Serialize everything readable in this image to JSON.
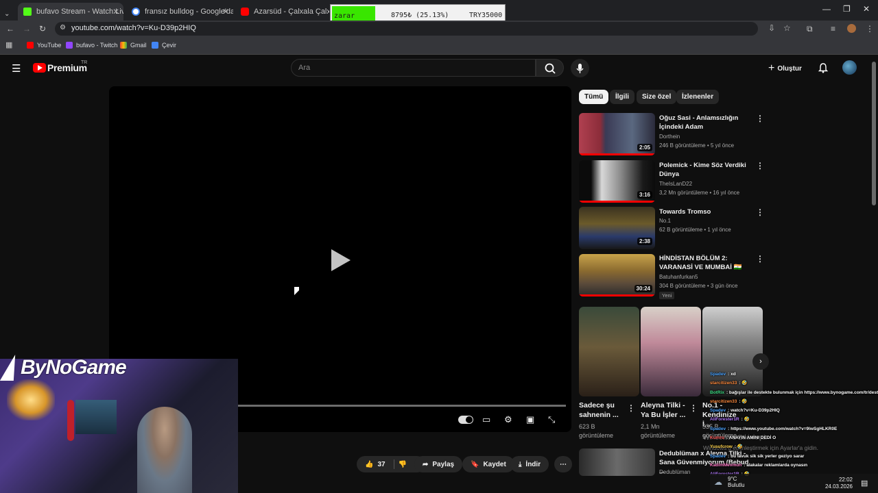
{
  "browser": {
    "tabs": [
      {
        "title": "bufavo Stream - Watch Live on",
        "color": "#53fc18"
      },
      {
        "title": "fransız bulldog - Google'da Ara",
        "color": "#4285f4"
      },
      {
        "title": "Azarsüd - Çalxala Çalxala Rekl",
        "color": "#ff0000"
      }
    ],
    "url": "youtube.com/watch?v=Ku-D39p2HIQ",
    "bookmarks": [
      "YouTube",
      "bufavo - Twitch",
      "Gmail",
      "Çevir"
    ]
  },
  "ticker": {
    "status": "zarar",
    "value": "8795₺ (25.13%)",
    "target": "TRY35000"
  },
  "masthead": {
    "logo": "Premium",
    "country": "TR",
    "search_placeholder": "Ara",
    "create_label": "Oluştur"
  },
  "action_bar": {
    "likes": "37",
    "share": "Paylaş",
    "save": "Kaydet",
    "download": "İndir"
  },
  "overlay": {
    "streamer_logo": "ByNoGame"
  },
  "chips": [
    "Tümü",
    "İlgili",
    "Size özel",
    "İzlenenler"
  ],
  "recommendations": [
    {
      "title": "Oğuz Sasi - Anlamsızlığın İçindeki Adam",
      "channel": "Dorthein",
      "meta": "246 B görüntüleme • 5 yıl önce",
      "duration": "2:05"
    },
    {
      "title": "Polemick - Kime Söz Verdiki Dünya",
      "channel": "TheIsLanD22",
      "meta": "3,2 Mn görüntüleme • 16 yıl önce",
      "duration": "3:16"
    },
    {
      "title": "Towards Tromso",
      "channel": "No.1",
      "meta": "62 B görüntüleme • 1 yıl önce",
      "duration": "2:38"
    },
    {
      "title": "HİNDİSTAN BÖLÜM 2: VARANASİ VE MUMBAİ 🇮🇳",
      "channel": "Batuhanfurkan5",
      "meta": "304 B görüntüleme • 3 gün önce",
      "duration": "30:24",
      "badge": "Yeni"
    }
  ],
  "shorts": [
    {
      "title": "Sadece şu sahnenin ...",
      "views": "623 B görüntüleme"
    },
    {
      "title": "Aleyna Tilki - Ya Bu İşler ...",
      "views": "2,1 Mn görüntüleme"
    },
    {
      "title": "No.1 - Kendinize İ...",
      "views": "535 B görüntüleme"
    }
  ],
  "bottom_rec": {
    "title": "Dedublüman x Aleyna Tilki - Sana Güvenmiyorum (Bebud ...",
    "channel": "Dedublüman"
  },
  "chat": [
    {
      "user": "Spadev",
      "color": "#4aa3ff",
      "msg": ": xd"
    },
    {
      "user": "starcitizen33",
      "color": "#ff8a3d",
      "msg": ": 🤣"
    },
    {
      "user": "BotRix",
      "color": "#3ddc84",
      "msg": ": bağışlar ile destekte bulunmak için https://www.bynogame.com/tr/destekle/bufavo"
    },
    {
      "user": "starcitizen33",
      "color": "#ff8a3d",
      "msg": ": 🤣"
    },
    {
      "user": "Spadev",
      "color": "#4aa3ff",
      "msg": ": watch?v=Ku-D39p2HIQ"
    },
    {
      "user": "AliForester1R",
      "color": "#b57bff",
      "msg": ": 🤣"
    },
    {
      "user": "Spadev",
      "color": "#4aa3ff",
      "msg": ": https://www.youtube.com/watch?v=9lwSgHLKR0E"
    },
    {
      "user": "Kumru",
      "color": "#ff5a5a",
      "msg": ": ANAYIN AMINI DEDİ O"
    },
    {
      "user": "Yusufcrow",
      "color": "#ffd34d",
      "msg": ": 🤣"
    },
    {
      "user": "Spadev",
      "color": "#4aa3ff",
      "msg": ": bu lavuk sik sik yerler geziyo sarar"
    },
    {
      "user": "KadimMevmun",
      "color": "#ff7ac6",
      "msg": ": alakalar reklamlarda oynasın"
    },
    {
      "user": "AliForester1R",
      "color": "#b57bff",
      "msg": ": 🤣"
    }
  ],
  "windows": {
    "activate_title": "Windows'u Etkinleştir",
    "activate_sub": "Windows'u etkinleştirmek için Ayarlar'a gidin.",
    "temp": "9°C",
    "weather": "Bulutlu",
    "time": "22:02",
    "date": "24.03.2026"
  }
}
